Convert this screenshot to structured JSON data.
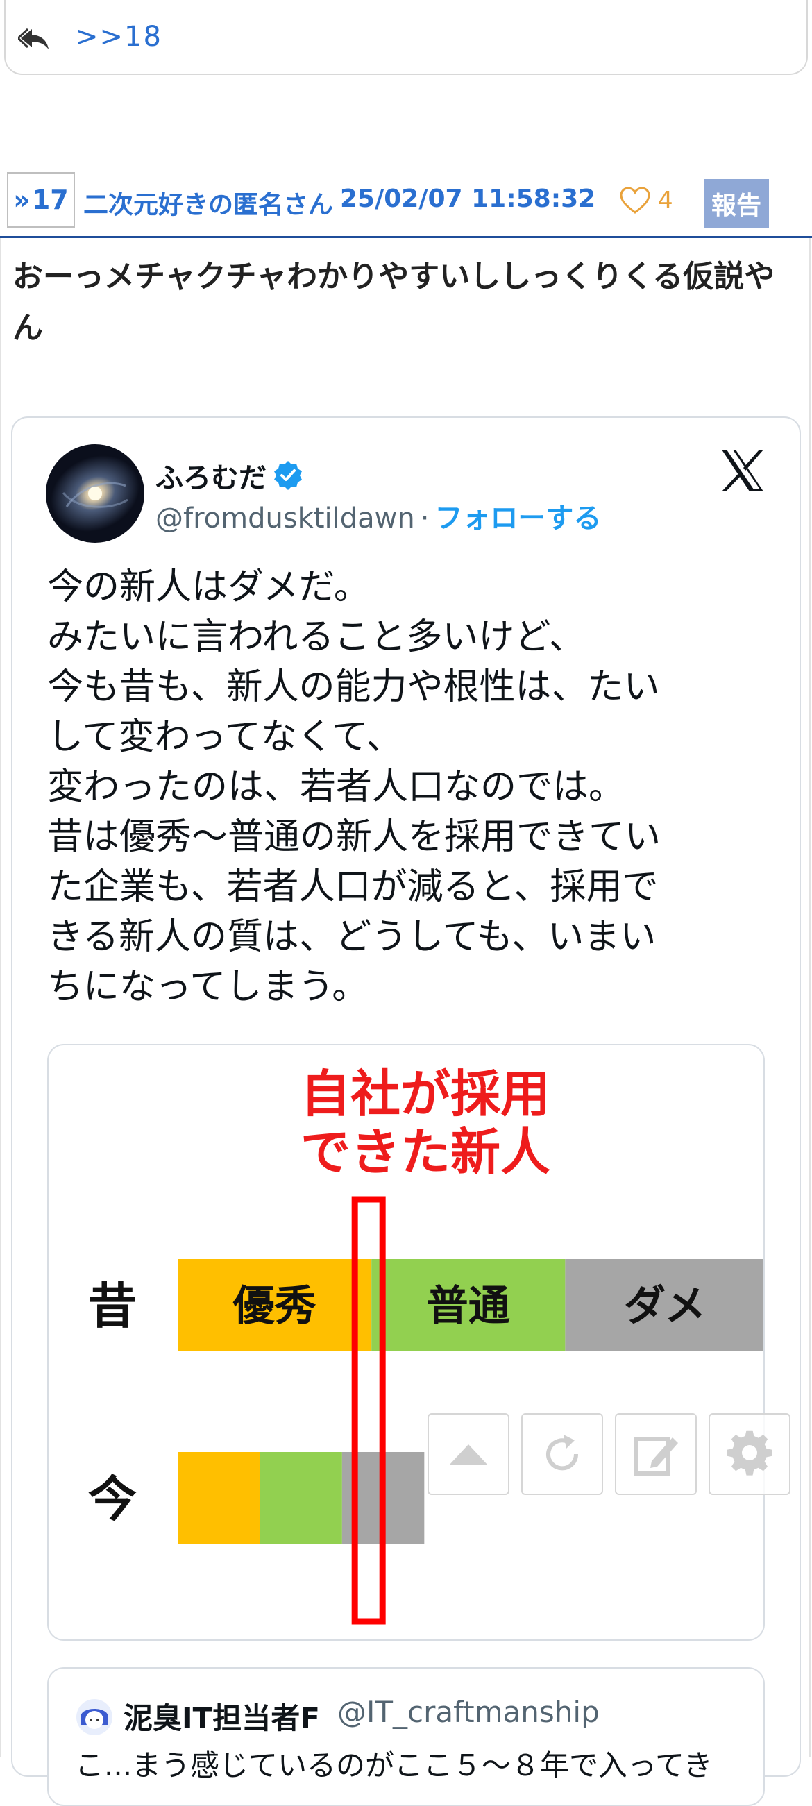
{
  "prev_post": {
    "anchor_link": ">>18"
  },
  "post": {
    "number": "17",
    "author": "二次元好きの匿名さん",
    "date": "25/02/07 11:58:32",
    "likes": "4",
    "report_label": "報告",
    "body": "おーっメチャクチャわかりやすいししっくりくる仮説やん"
  },
  "tweet": {
    "display_name": "ふろむだ",
    "handle": "@fromdusktildawn",
    "separator": "·",
    "follow_label": "フォローする",
    "text_lines": [
      "今の新人はダメだ。",
      "みたいに言われること多いけど、",
      "今も昔も、新人の能力や根性は、たい",
      "して変わってなくて、",
      "変わったのは、若者人口なのでは。",
      "昔は優秀〜普通の新人を採用できてい",
      "た企業も、若者人口が減ると、採用で",
      "きる新人の質は、どうしても、いまい",
      "ちになってしまう。"
    ],
    "quote": {
      "name": "泥臭IT担当者F",
      "handle": "@IT_craftmanship",
      "text": "こ...まう感じているのがここ５〜８年で入ってき"
    }
  },
  "chart_data": {
    "type": "bar",
    "orientation": "horizontal-stacked",
    "title_lines": [
      "自社が採用",
      "できた新人"
    ],
    "categories": [
      "昔",
      "今"
    ],
    "series": [
      {
        "name": "優秀",
        "color": "#ffbf00",
        "values": [
          0.33,
          0.14
        ]
      },
      {
        "name": "普通",
        "color": "#92d050",
        "values": [
          0.33,
          0.14
        ]
      },
      {
        "name": "ダメ",
        "color": "#a6a6a6",
        "values": [
          0.34,
          0.14
        ]
      }
    ],
    "hiring_cutoff": 0.33,
    "highlight_color": "#ff0000"
  },
  "colors": {
    "link": "#2a6fd0",
    "header_rule": "#1f4e9a",
    "like": "#e9a23b",
    "report_bg": "#8fa8d6",
    "twitter_blue": "#1d9bf0"
  },
  "toolbar": {
    "icons": [
      "scroll-top-icon",
      "reload-icon",
      "edit-icon",
      "settings-icon"
    ]
  }
}
